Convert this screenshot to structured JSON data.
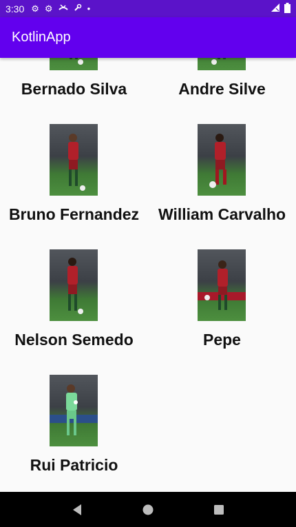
{
  "status_bar": {
    "time": "3:30",
    "icons": [
      "settings-icon",
      "settings-icon",
      "missed-call-icon",
      "wrench-icon",
      "dot-icon"
    ],
    "right_icons": [
      "wifi-signal-icon",
      "battery-icon"
    ]
  },
  "app_bar": {
    "title": "KotlinApp",
    "color": "#6200ee"
  },
  "players": [
    {
      "name": "Bernado Silva"
    },
    {
      "name": "Andre Silve"
    },
    {
      "name": "Bruno Fernandez"
    },
    {
      "name": "William Carvalho"
    },
    {
      "name": "Nelson Semedo"
    },
    {
      "name": "Pepe"
    },
    {
      "name": "Rui Patricio"
    }
  ],
  "nav_bar": {
    "buttons": [
      "back-icon",
      "home-icon",
      "recents-icon"
    ]
  }
}
